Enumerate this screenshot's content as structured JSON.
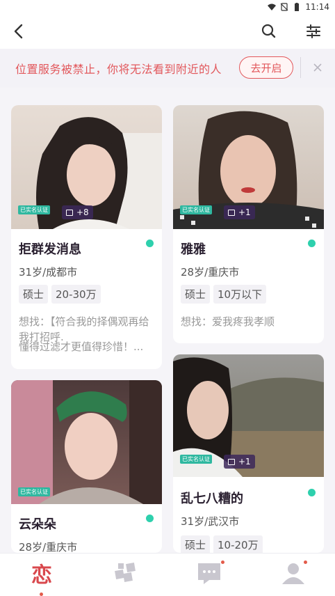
{
  "status": {
    "time": "11:14",
    "icons": [
      "wifi-icon",
      "no-sim-icon",
      "battery-icon"
    ]
  },
  "header": {
    "icons": [
      "back-icon",
      "search-icon",
      "filter-icon"
    ]
  },
  "banner": {
    "text": "位置服务被禁止，你将无法看到附近的人",
    "button": "去开启"
  },
  "cards": [
    {
      "name": "拒群发消息",
      "age_city": "31岁/成都市",
      "tags": [
        "硕士",
        "20-30万"
      ],
      "want": "想找：【符合我的择偶观再给我打招呼.",
      "want2": "懂得过滤才更值得珍惜！...",
      "photos": "+8",
      "verified": "已实名认证"
    },
    {
      "name": "雅雅",
      "age_city": "28岁/重庆市",
      "tags": [
        "硕士",
        "10万以下"
      ],
      "want": "想找：爱我疼我孝顺",
      "photos": "+1",
      "verified": "已实名认证"
    },
    {
      "name": "云朵朵",
      "age_city": "28岁/重庆市",
      "verified": "已实名认证"
    },
    {
      "name": "乱七八糟的",
      "age_city": "31岁/武汉市",
      "tags": [
        "硕士",
        "10-20万"
      ],
      "photos": "+1",
      "verified": "已实名认证"
    }
  ],
  "tabbar": {
    "love": "恋",
    "icons": [
      "love-tab-icon",
      "discover-icon",
      "messages-icon",
      "profile-icon"
    ]
  },
  "colors": {
    "accent": "#e2575b",
    "online": "#2ed0ad",
    "verified": "#2fb8a0",
    "name": "#2a2030"
  }
}
